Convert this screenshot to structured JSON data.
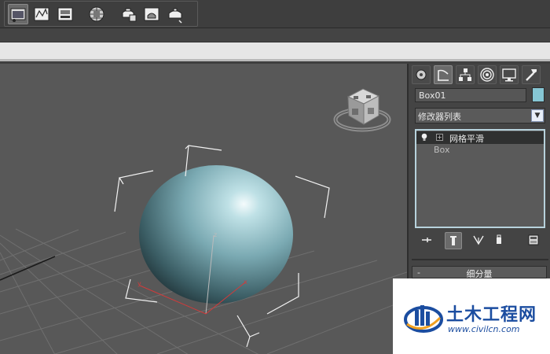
{
  "toolbar": {
    "buttons": [
      "render-setup-icon",
      "material-editor-icon",
      "render-frame-icon",
      "environment-icon",
      "render-icon",
      "rendered-frame-window-icon",
      "quick-render-icon"
    ]
  },
  "command_panel": {
    "tabs": [
      "create-tab",
      "modify-tab",
      "hierarchy-tab",
      "motion-tab",
      "display-tab",
      "utilities-tab"
    ],
    "active_tab": "modify-tab",
    "object_name": "Box01",
    "object_color": "#86c6d4",
    "modifier_list_label": "修改器列表",
    "stack": [
      {
        "label": "网格平滑",
        "selected": true
      },
      {
        "label": "Box",
        "selected": false
      }
    ],
    "rollout_title": "细分量",
    "rollout_state": "-"
  },
  "watermark": {
    "title": "土木工程网",
    "url": "www.civilcn.com"
  }
}
